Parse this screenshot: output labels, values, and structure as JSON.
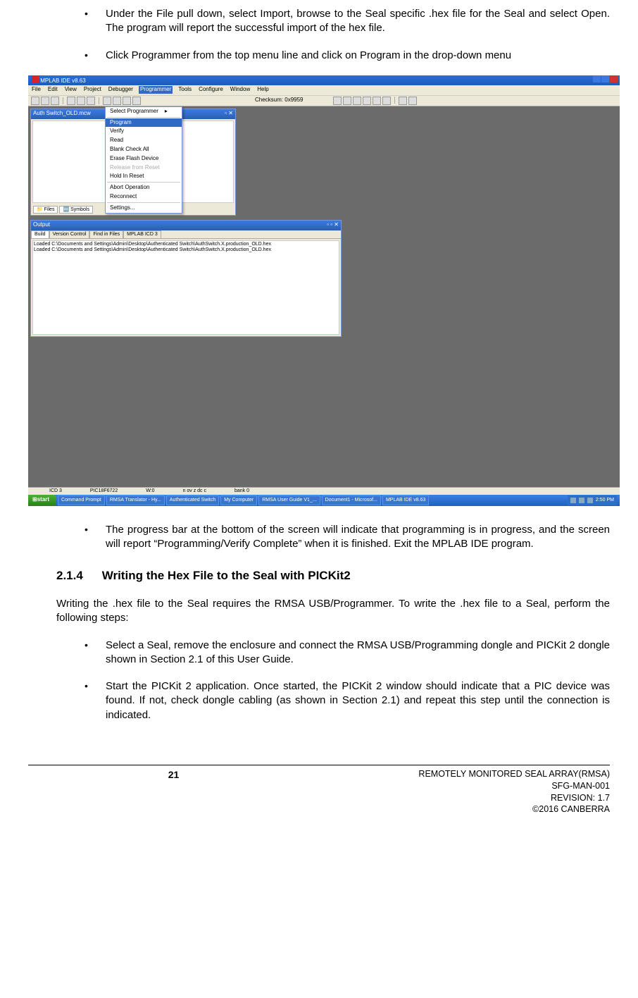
{
  "top_bullets": [
    "Under the File pull down, select Import, browse to the Seal specific .hex file for the Seal and select Open.  The program will report the successful import of the hex file.",
    "Click Programmer from the top menu line and click on Program in the drop-down menu"
  ],
  "mplab": {
    "title": "MPLAB IDE v8.63",
    "menu": [
      "File",
      "Edit",
      "View",
      "Project",
      "Debugger",
      "Programmer",
      "Tools",
      "Configure",
      "Window",
      "Help"
    ],
    "active_menu_index": 5,
    "checksum_label": "Checksum:",
    "checksum_value": "0x9959",
    "dropdown": {
      "top_item": "Select Programmer",
      "items": [
        {
          "label": "Program",
          "sel": true
        },
        {
          "label": "Verify"
        },
        {
          "label": "Read"
        },
        {
          "label": "Blank Check All"
        },
        {
          "label": "Erase Flash Device"
        },
        {
          "label": "Release from Reset",
          "dis": true
        },
        {
          "label": "Hold In Reset"
        }
      ],
      "group2": [
        "Abort Operation",
        "Reconnect"
      ],
      "group3": [
        "Settings..."
      ]
    },
    "left_panel": {
      "title": "Auth Switch_OLD.mcw",
      "tabs": [
        "Files",
        "Symbols"
      ]
    },
    "output_panel": {
      "title": "Output",
      "tabs": [
        "Build",
        "Version Control",
        "Find in Files",
        "MPLAB ICD 3"
      ],
      "lines": [
        "Loaded C:\\Documents and Settings\\Admin\\Desktop\\Authenticated Switch\\AuthSwitch.X.production_OLD.hex",
        "Loaded C:\\Documents and Settings\\Admin\\Desktop\\Authenticated Switch\\AuthSwitch.X.production_OLD.hex"
      ]
    },
    "statusbar": [
      "ICD 3",
      "PIC18F6722",
      "W:0",
      "n ov z dc c",
      "bank 0"
    ],
    "taskbar": {
      "start": "start",
      "items": [
        "Command Prompt",
        "RMSA Translator - Hy...",
        "Authenticated Switch",
        "My Computer",
        "RMSA User Guide V1_...",
        "Document1 - Microsof...",
        "MPLAB IDE v8.63"
      ],
      "time": "2:50 PM"
    }
  },
  "after_bullet": "The progress bar at the bottom of the screen will indicate that programming is in progress, and the screen will report “Programming/Verify Complete” when it is finished.  Exit the MPLAB IDE program.",
  "section": {
    "num": "2.1.4",
    "title": "Writing the Hex File to the Seal with PICKit2"
  },
  "intro_para": "Writing the .hex file to the Seal requires the RMSA USB/Programmer.  To write the .hex file to a Seal, perform the following steps:",
  "lower_bullets": [
    "Select a Seal, remove the enclosure and connect the RMSA USB/Programming dongle and PICKit 2 dongle shown in Section 2.1 of this User Guide.",
    "Start the PICKit 2 application.  Once started, the PICKit 2 window should indicate that a PIC device was found.  If not, check dongle cabling (as shown in Section 2.1) and repeat this step until the connection is indicated."
  ],
  "footer": {
    "page": "21",
    "lines": [
      "REMOTELY MONITORED SEAL ARRAY(RMSA)",
      "SFG-MAN-001",
      "REVISION: 1.7",
      "©2016 CANBERRA"
    ]
  }
}
